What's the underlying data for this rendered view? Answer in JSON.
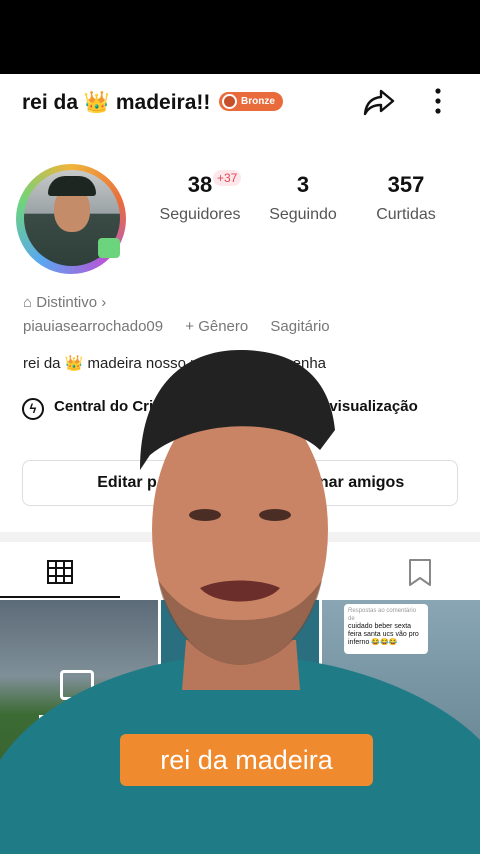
{
  "profile": {
    "name": "rei da 👑 madeira!!",
    "badge": "Bronze",
    "avatar_decoration": "camera-sticker"
  },
  "stats": [
    {
      "value": "38",
      "label": "Seguidores"
    },
    {
      "value": "3",
      "label": "Seguindo"
    },
    {
      "value": "357",
      "label": "Curtidas"
    }
  ],
  "followers_delta": "+37",
  "distintivo": "Distintivo ›",
  "username": "piauiasearrochado09",
  "gender": "+ Gênero",
  "sign": "Sagitário",
  "bio": "rei da 👑 madeira nosso pfl de muito resenha",
  "shortcuts": {
    "creator": "Central do Cri",
    "history": "co de visualização"
  },
  "buttons": {
    "edit": "Editar p",
    "add_friends": "cionar amigos"
  },
  "tabs": {
    "grid": "grid-icon",
    "saved": "bookmark-icon"
  },
  "draft": {
    "label": "Rascu",
    "count": "20"
  },
  "comment": {
    "header": "Respostas ao comentário de",
    "text": "cuidado beber sexta feira santa ucs vão pro inferno 😂😂😂"
  },
  "caption": "rei da madeira",
  "colors": {
    "badge": "#e96b3c",
    "caption_bg": "#f08a2e",
    "delta": "#e04a5a"
  }
}
